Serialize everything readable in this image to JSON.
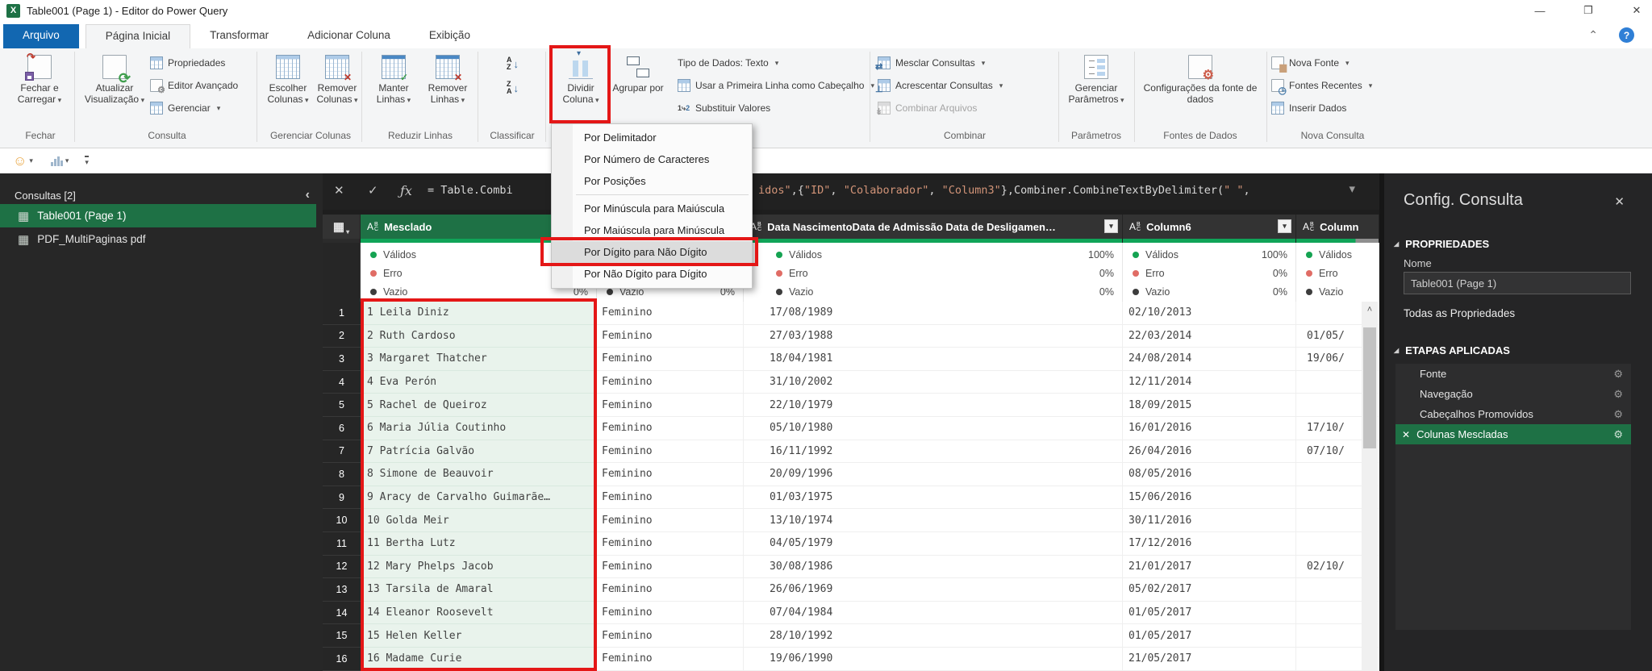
{
  "colors": {
    "accent": "#1267b1",
    "green": "#1e7145",
    "red": "#e41717",
    "qgreen": "#10a458",
    "salmon": "#d29478"
  },
  "icons": {
    "excel_logo": "X",
    "minimize": "—",
    "restore": "❐",
    "close": "✕",
    "chevron_up": "⌃",
    "help": "?",
    "smiley": "☺",
    "dropdown_caret": "▾",
    "collapse_left": "‹",
    "table_grid": "▦",
    "gear": "⚙",
    "step_delete": "✕",
    "cancel": "✕",
    "accept": "✓",
    "fx": "ƒx",
    "scroll_up": "˄",
    "section_triangle": "◢",
    "panel_close": "✕",
    "filter_caret": "▾"
  },
  "window": {
    "title": "Table001 (Page 1) - Editor do Power Query"
  },
  "tabs": [
    {
      "label": "Arquivo",
      "file": true
    },
    {
      "label": "Página Inicial",
      "active": true
    },
    {
      "label": "Transformar"
    },
    {
      "label": "Adicionar Coluna"
    },
    {
      "label": "Exibição"
    }
  ],
  "ribbon": {
    "close_load": "Fechar e Carregar",
    "refresh_preview": "Atualizar Visualização",
    "properties": "Propriedades",
    "advanced_editor": "Editor Avançado",
    "manage": "Gerenciar",
    "choose_columns": "Escolher Colunas",
    "remove_columns": "Remover Colunas",
    "keep_rows": "Manter Linhas",
    "remove_rows": "Remover Linhas",
    "split_column": "Dividir Coluna",
    "group_by": "Agrupar por",
    "data_type": "Tipo de Dados: Texto",
    "first_row_header": "Usar a Primeira Linha como Cabeçalho",
    "replace_values": "Substituir Valores",
    "merge_queries": "Mesclar Consultas",
    "append_queries": "Acrescentar Consultas",
    "combine_files": "Combinar Arquivos",
    "manage_params": "Gerenciar Parâmetros",
    "ds_settings": "Configurações da fonte de dados",
    "new_source": "Nova Fonte",
    "recent_sources": "Fontes Recentes",
    "enter_data": "Inserir Dados",
    "sort_az": "AZ",
    "sort_za": "ZA",
    "replace_badge_1": "1",
    "replace_badge_2": "2",
    "groups": {
      "fechar": "Fechar",
      "consulta": "Consulta",
      "gerenciar_colunas": "Gerenciar Colunas",
      "reduzir_linhas": "Reduzir Linhas",
      "classificar": "Classificar",
      "combinar": "Combinar",
      "parametros": "Parâmetros",
      "fontes_dados": "Fontes de Dados",
      "nova_consulta": "Nova Consulta"
    }
  },
  "menu": {
    "items": [
      "Por Delimitador",
      "Por Número de Caracteres",
      "Por Posições",
      "Por Minúscula para Maiúscula",
      "Por Maiúscula para Minúscula",
      "Por Dígito para Não Dígito",
      "Por Não Dígito para Dígito"
    ],
    "separator_after": [
      2
    ],
    "highlighted_index": 5
  },
  "queries_panel": {
    "title": "Consultas [2]",
    "items": [
      {
        "name": "Table001 (Page 1)",
        "selected": true
      },
      {
        "name": "PDF_MultiPaginas pdf",
        "selected": false
      }
    ]
  },
  "formula": {
    "left": "= Table.Combi",
    "right_tokens": [
      {
        "kind": "str",
        "text": "idos\""
      },
      {
        "kind": "code",
        "text": ",{"
      },
      {
        "kind": "str",
        "text": "\"ID\""
      },
      {
        "kind": "code",
        "text": ", "
      },
      {
        "kind": "str",
        "text": "\"Colaborador\""
      },
      {
        "kind": "code",
        "text": ", "
      },
      {
        "kind": "str",
        "text": "\"Column3\""
      },
      {
        "kind": "code",
        "text": "},Combiner.CombineTextByDelimiter("
      },
      {
        "kind": "str",
        "text": "\" \""
      },
      {
        "kind": "code",
        "text": ","
      }
    ]
  },
  "grid": {
    "quality_labels": {
      "valid": "Válidos",
      "error": "Erro",
      "empty": "Vazio"
    },
    "columns": [
      {
        "header": "Mesclado",
        "type": "ABC",
        "selected": true,
        "filter": true,
        "quality": {
          "valid": "",
          "error": "",
          "empty": "0%"
        }
      },
      {
        "header": "",
        "type": "ABC",
        "selected": false,
        "filter": true,
        "quality": {
          "valid": "",
          "error": "",
          "empty": "0%"
        }
      },
      {
        "header": "Data NascimentoData de Admissão Data de Desligamen…",
        "type": "ABC",
        "selected": false,
        "filter": true,
        "quality": {
          "valid": "100%",
          "error": "0%",
          "empty": "0%"
        }
      },
      {
        "header": "Column6",
        "type": "ABC",
        "selected": false,
        "filter": true,
        "quality": {
          "valid": "100%",
          "error": "0%",
          "empty": "0%"
        }
      },
      {
        "header": "Column",
        "type": "ABC",
        "selected": false,
        "filter": false,
        "quality": {
          "valid": "",
          "error": "",
          "empty": ""
        }
      }
    ],
    "rows": [
      [
        "1 Leila Diniz",
        "Feminino",
        "17/08/1989",
        "02/10/2013",
        ""
      ],
      [
        "2 Ruth Cardoso",
        "Feminino",
        "27/03/1988",
        "22/03/2014",
        "01/05/"
      ],
      [
        "3 Margaret Thatcher",
        "Feminino",
        "18/04/1981",
        "24/08/2014",
        "19/06/"
      ],
      [
        "4 Eva Perón",
        "Feminino",
        "31/10/2002",
        "12/11/2014",
        ""
      ],
      [
        "5 Rachel de Queiroz",
        "Feminino",
        "22/10/1979",
        "18/09/2015",
        ""
      ],
      [
        "6 Maria Júlia Coutinho",
        "Feminino",
        "05/10/1980",
        "16/01/2016",
        "17/10/"
      ],
      [
        "7 Patrícia Galvão",
        "Feminino",
        "16/11/1992",
        "26/04/2016",
        "07/10/"
      ],
      [
        "8 Simone de Beauvoir",
        "Feminino",
        "20/09/1996",
        "08/05/2016",
        ""
      ],
      [
        "9 Aracy de Carvalho Guimarãe…",
        "Feminino",
        "01/03/1975",
        "15/06/2016",
        ""
      ],
      [
        "10 Golda Meir",
        "Feminino",
        "13/10/1974",
        "30/11/2016",
        ""
      ],
      [
        "11 Bertha Lutz",
        "Feminino",
        "04/05/1979",
        "17/12/2016",
        ""
      ],
      [
        "12 Mary Phelps Jacob",
        "Feminino",
        "30/08/1986",
        "21/01/2017",
        "02/10/"
      ],
      [
        "13 Tarsila de Amaral",
        "Feminino",
        "26/06/1969",
        "05/02/2017",
        ""
      ],
      [
        "14 Eleanor Roosevelt",
        "Feminino",
        "07/04/1984",
        "01/05/2017",
        ""
      ],
      [
        "15 Helen Keller",
        "Feminino",
        "28/10/1992",
        "01/05/2017",
        ""
      ],
      [
        "16 Madame Curie",
        "Feminino",
        "19/06/1990",
        "21/05/2017",
        ""
      ]
    ]
  },
  "config_panel": {
    "title": "Config. Consulta",
    "properties_header": "PROPRIEDADES",
    "name_label": "Nome",
    "name_value": "Table001 (Page 1)",
    "all_properties": "Todas as Propriedades",
    "steps_header": "ETAPAS APLICADAS",
    "steps": [
      {
        "name": "Fonte",
        "selected": false
      },
      {
        "name": "Navegação",
        "selected": false
      },
      {
        "name": "Cabeçalhos Promovidos",
        "selected": false
      },
      {
        "name": "Colunas Mescladas",
        "selected": true
      }
    ]
  }
}
